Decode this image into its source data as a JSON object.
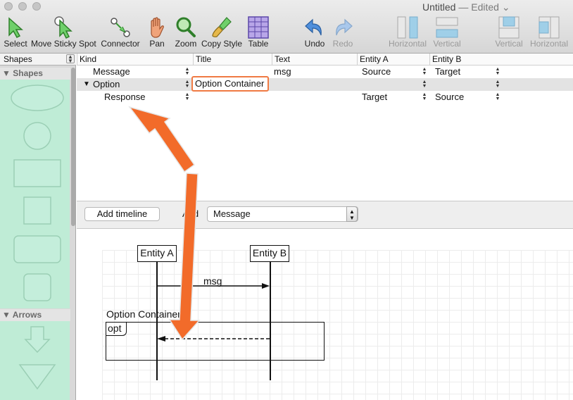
{
  "window": {
    "title": "Untitled",
    "edited": "— Edited"
  },
  "toolbar": {
    "select": "Select",
    "move_sticky_spot": "Move Sticky Spot",
    "connector": "Connector",
    "pan": "Pan",
    "zoom": "Zoom",
    "copy_style": "Copy Style",
    "table": "Table",
    "undo": "Undo",
    "redo": "Redo",
    "align_horizontal": "Horizontal",
    "align_vertical": "Vertical",
    "split_vertical": "Vertical",
    "split_horizontal": "Horizontal"
  },
  "sidebar": {
    "selector": "Shapes",
    "section_shapes": "Shapes",
    "section_arrows": "Arrows"
  },
  "table": {
    "headers": [
      "Kind",
      "Title",
      "Text",
      "Entity A",
      "Entity B"
    ],
    "rows": [
      {
        "kind": "Message",
        "title": "",
        "text": "msg",
        "entity_a": "Source",
        "entity_b": "Target"
      },
      {
        "kind": "Option",
        "title": "Option Container",
        "text": "",
        "entity_a": "",
        "entity_b": ""
      },
      {
        "kind": "Response",
        "title": "",
        "text": "",
        "entity_a": "Target",
        "entity_b": "Source"
      }
    ]
  },
  "controls": {
    "add_timeline": "Add timeline",
    "and_label": "And",
    "message_select": "Message"
  },
  "diagram": {
    "entity_a": "Entity A",
    "entity_b": "Entity B",
    "message_label": "msg",
    "option_title": "Option Container",
    "option_tag": "opt"
  },
  "colors": {
    "accent_orange": "#f26b2a",
    "shapes_panel": "#bfecd6"
  }
}
